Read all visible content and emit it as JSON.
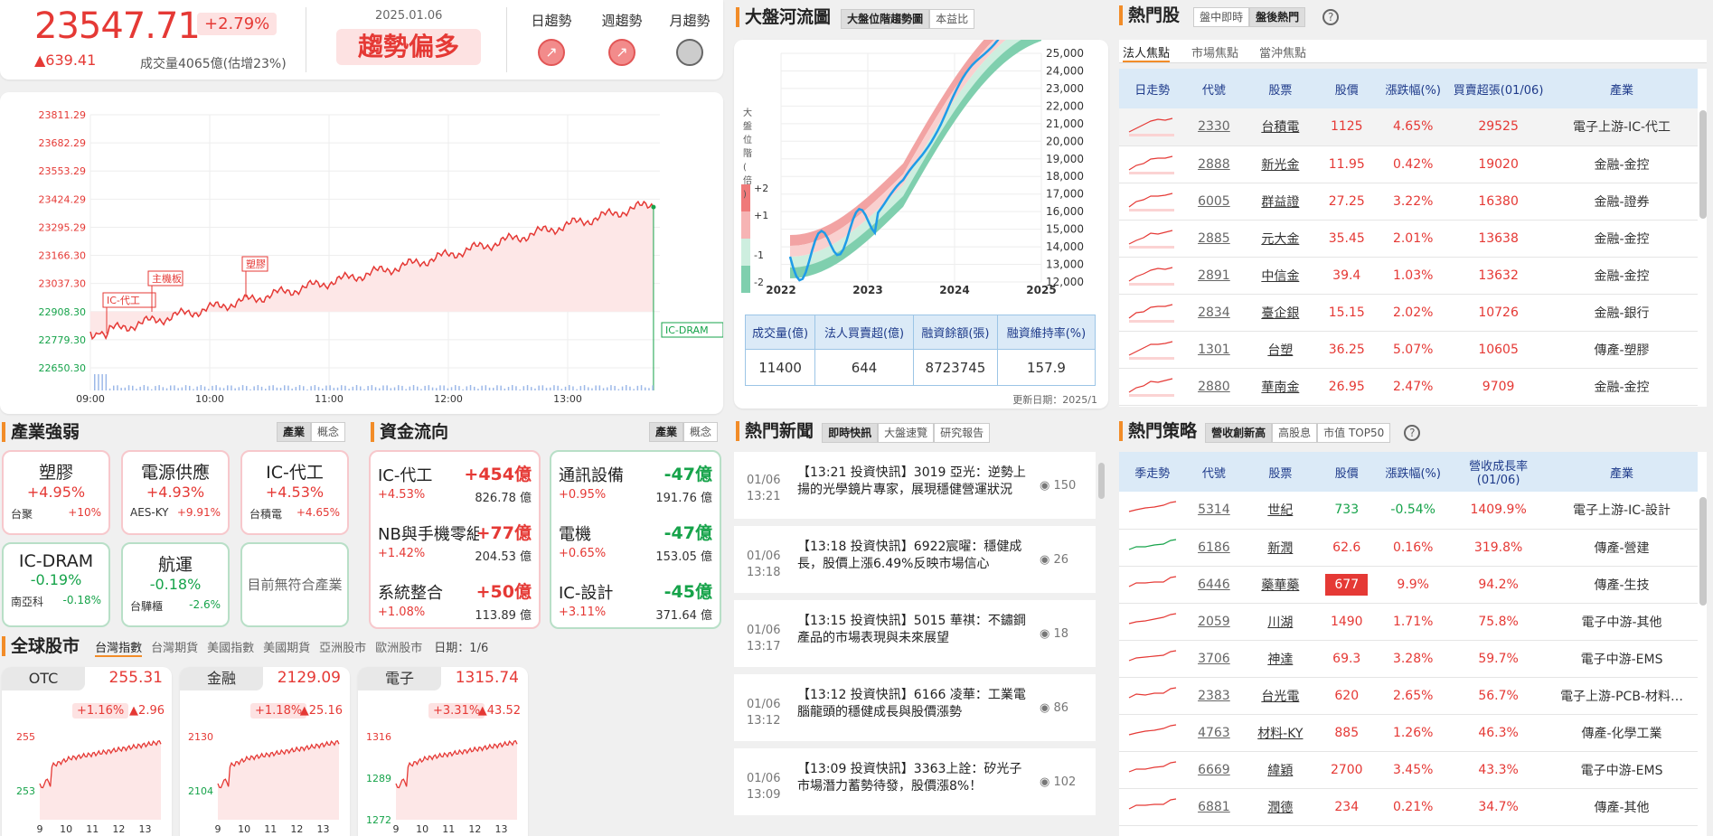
{
  "colors": {
    "up": "#e53935",
    "down": "#16a34a",
    "accent": "#f28c28",
    "header": "#dbeaf7"
  },
  "index": {
    "value": "23547.71",
    "pct": "+2.79%",
    "change": "▲639.41",
    "volume": "成交量4065億(估增23%)",
    "date": "2025.01.06",
    "trend": "趨勢偏多",
    "trend_labels": [
      "日趨勢",
      "週趨勢",
      "月趨勢"
    ]
  },
  "intraday": {
    "y_ticks": [
      "23811.29",
      "23682.29",
      "23553.29",
      "23424.29",
      "23295.29",
      "23166.30",
      "23037.30",
      "22908.30",
      "22779.30",
      "22650.30"
    ],
    "x_ticks": [
      "09:00",
      "10:00",
      "11:00",
      "12:00",
      "13:00"
    ],
    "tags": [
      "IC-代工",
      "主機板",
      "塑膠",
      "IC-DRAM"
    ]
  },
  "river": {
    "title": "大盤河流圖",
    "tab1": "大盤位階趨勢圖",
    "tab2": "本益比",
    "ylabel": "大盤位階(倍)",
    "y_ticks": [
      "25,000",
      "24,000",
      "23,000",
      "22,000",
      "21,000",
      "20,000",
      "19,000",
      "18,000",
      "17,000",
      "16,000",
      "15,000",
      "14,000",
      "13,000",
      "12,000"
    ],
    "x_ticks": [
      "2022",
      "2023",
      "2024",
      "2025"
    ],
    "bands": [
      "+2",
      "+1",
      "-1",
      "-2"
    ],
    "table_head": [
      "成交量(億)",
      "法人買賣超(億)",
      "融資餘額(張)",
      "融資維持率(%)"
    ],
    "table_vals": [
      "11400",
      "644",
      "8723745",
      "157.9"
    ],
    "updated": "更新日期：2025/1"
  },
  "hot": {
    "title": "熱門股",
    "tabs": [
      "盤中即時",
      "盤後熱門"
    ],
    "subtabs": [
      "法人焦點",
      "市場焦點",
      "當沖焦點"
    ],
    "head": [
      "日走勢",
      "代號",
      "股票",
      "股價",
      "漲跌幅(%)",
      "買賣超張(01/06)",
      "產業"
    ],
    "rows": [
      [
        "2330",
        "台積電",
        "1125",
        "4.65%",
        "29525",
        "電子上游-IC-代工"
      ],
      [
        "2888",
        "新光金",
        "11.95",
        "0.42%",
        "19020",
        "金融-金控"
      ],
      [
        "6005",
        "群益證",
        "27.25",
        "3.22%",
        "16380",
        "金融-證券"
      ],
      [
        "2885",
        "元大金",
        "35.45",
        "2.01%",
        "13638",
        "金融-金控"
      ],
      [
        "2891",
        "中信金",
        "39.4",
        "1.03%",
        "13632",
        "金融-金控"
      ],
      [
        "2834",
        "臺企銀",
        "15.15",
        "2.02%",
        "10726",
        "金融-銀行"
      ],
      [
        "1301",
        "台塑",
        "36.25",
        "5.07%",
        "10605",
        "傳產-塑膠"
      ],
      [
        "2880",
        "華南金",
        "26.95",
        "2.47%",
        "9709",
        "金融-金控"
      ]
    ]
  },
  "industry": {
    "title": "產業強弱",
    "tab1": "產業",
    "tab2": "概念",
    "tiles": [
      {
        "name": "塑膠",
        "pct": "+4.95%",
        "stock": "台聚",
        "spct": "+10%"
      },
      {
        "name": "電源供應",
        "pct": "+4.93%",
        "stock": "AES-KY",
        "spct": "+9.91%"
      },
      {
        "name": "IC-代工",
        "pct": "+4.53%",
        "stock": "台積電",
        "spct": "+4.65%"
      },
      {
        "name": "IC-DRAM",
        "pct": "-0.19%",
        "stock": "南亞科",
        "spct": "-0.18%"
      },
      {
        "name": "航運",
        "pct": "-0.18%",
        "stock": "台驊櫃",
        "spct": "-2.6%"
      }
    ],
    "empty": "目前無符合產業"
  },
  "flow": {
    "title": "資金流向",
    "tab1": "產業",
    "tab2": "概念",
    "left": [
      {
        "name": "IC-代工",
        "amt": "+454億",
        "pct": "+4.53%",
        "vol": "826.78 億"
      },
      {
        "name": "NB與手機零組",
        "amt": "+77億",
        "pct": "+1.42%",
        "vol": "204.53 億"
      },
      {
        "name": "系統整合",
        "amt": "+50億",
        "pct": "+1.08%",
        "vol": "113.89 億"
      }
    ],
    "right": [
      {
        "name": "通訊設備",
        "amt": "-47億",
        "pct": "+0.95%",
        "vol": "191.76 億"
      },
      {
        "name": "電機",
        "amt": "-47億",
        "pct": "+0.65%",
        "vol": "153.05 億"
      },
      {
        "name": "IC-設計",
        "amt": "-45億",
        "pct": "+3.11%",
        "vol": "371.64 億"
      }
    ]
  },
  "news": {
    "title": "熱門新聞",
    "tabs": [
      "即時快訊",
      "大盤速覽",
      "研究報告"
    ],
    "items": [
      {
        "d": "01/06",
        "t": "13:21",
        "text": "【13:21 投資快訊】3019 亞光：逆勢上揚的光學鏡片專家，展現穩健營運狀況",
        "v": "150"
      },
      {
        "d": "01/06",
        "t": "13:18",
        "text": "【13:18 投資快訊】6922宸曜：穩健成長，股價上漲6.49%反映市場信心",
        "v": "26"
      },
      {
        "d": "01/06",
        "t": "13:17",
        "text": "【13:15 投資快訊】5015 華祺：不鏽鋼產品的市場表現與未來展望",
        "v": "18"
      },
      {
        "d": "01/06",
        "t": "13:12",
        "text": "【13:12 投資快訊】6166 凌華：工業電腦龍頭的穩健成長與股價漲勢",
        "v": "86"
      },
      {
        "d": "01/06",
        "t": "13:09",
        "text": "【13:09 投資快訊】3363上詮：矽光子市場潛力蓄勢待發，股價漲8%！",
        "v": "102"
      }
    ]
  },
  "strategy": {
    "title": "熱門策略",
    "tabs": [
      "營收創新高",
      "高股息",
      "市值 TOP50"
    ],
    "head": [
      "季走勢",
      "代號",
      "股票",
      "股價",
      "漲跌幅(%)",
      "營收成長率(01/06)",
      "產業"
    ],
    "rows": [
      [
        "5314",
        "世紀",
        "733",
        "-0.54%",
        "1409.9%",
        "電子上游-IC-設計"
      ],
      [
        "6186",
        "新潤",
        "62.6",
        "0.16%",
        "319.8%",
        "傳產-營建"
      ],
      [
        "6446",
        "藥華藥",
        "677",
        "9.9%",
        "94.2%",
        "傳產-生技"
      ],
      [
        "2059",
        "川湖",
        "1490",
        "1.71%",
        "75.8%",
        "電子中游-其他"
      ],
      [
        "3706",
        "神達",
        "69.3",
        "3.28%",
        "59.7%",
        "電子中游-EMS"
      ],
      [
        "2383",
        "台光電",
        "620",
        "2.65%",
        "56.7%",
        "電子上游-PCB-材料…"
      ],
      [
        "4763",
        "材料-KY",
        "885",
        "1.26%",
        "46.3%",
        "傳產-化學工業"
      ],
      [
        "6669",
        "緯穎",
        "2700",
        "3.45%",
        "43.3%",
        "電子中游-EMS"
      ],
      [
        "6881",
        "潤德",
        "234",
        "0.21%",
        "34.7%",
        "傳產-其他"
      ]
    ]
  },
  "global": {
    "title": "全球股市",
    "tabs": [
      "台灣指數",
      "台灣期貨",
      "美國指數",
      "美國期貨",
      "亞洲股市",
      "歐洲股市"
    ],
    "date": "日期：1/6",
    "cards": [
      {
        "name": "OTC",
        "price": "255.31",
        "pct": "+1.16%",
        "chg": "▲2.96",
        "yt": [
          "255",
          "253"
        ],
        "ylow": ""
      },
      {
        "name": "金融",
        "price": "2129.09",
        "pct": "+1.18%",
        "chg": "▲25.16",
        "yt": [
          "2130",
          "2104"
        ],
        "ylow": ""
      },
      {
        "name": "電子",
        "price": "1315.74",
        "pct": "+3.31%",
        "chg": "▲43.52",
        "yt": [
          "1316",
          "1289",
          "1272"
        ],
        "ylow": ""
      }
    ],
    "xt": [
      "9",
      "10",
      "11",
      "12",
      "13"
    ]
  }
}
